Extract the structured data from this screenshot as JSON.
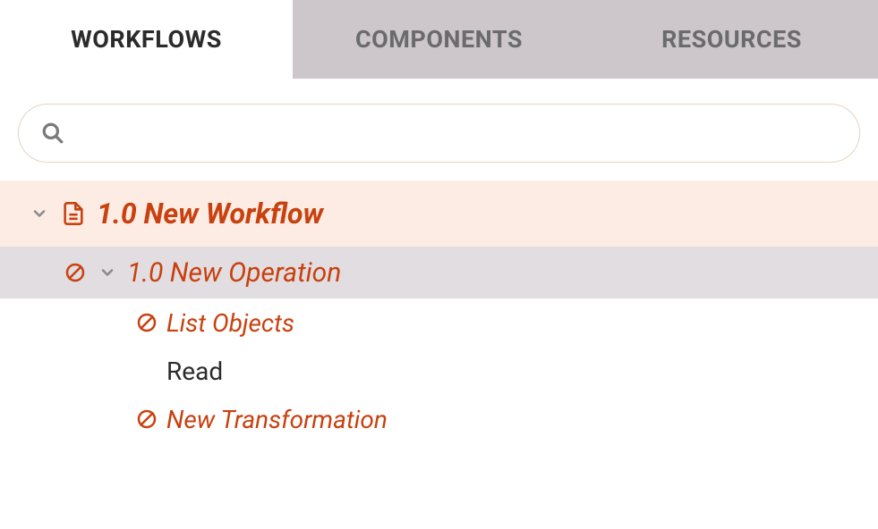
{
  "colors": {
    "accent": "#c8410f",
    "tab_inactive_bg": "#cdc7cb",
    "tab_inactive_fg": "#6b6b6b",
    "selected_bg": "#fdece4",
    "highlight_bg": "#e1dde0"
  },
  "tabs": {
    "items": [
      {
        "label": "WORKFLOWS",
        "active": true
      },
      {
        "label": "COMPONENTS",
        "active": false
      },
      {
        "label": "RESOURCES",
        "active": false
      }
    ]
  },
  "search": {
    "icon": "search-icon",
    "placeholder": "",
    "value": ""
  },
  "tree": {
    "workflow": {
      "icon": "document-icon",
      "expand_icon": "chevron-down-icon",
      "label": "1.0 New Workflow"
    },
    "operation": {
      "status_icon": "prohibit-icon",
      "expand_icon": "chevron-down-icon",
      "label": "1.0 New Operation"
    },
    "children": [
      {
        "status_icon": "prohibit-icon",
        "label": "List Objects",
        "style": "accent"
      },
      {
        "status_icon": null,
        "label": "Read",
        "style": "normal"
      },
      {
        "status_icon": "prohibit-icon",
        "label": "New Transformation",
        "style": "accent"
      }
    ]
  }
}
